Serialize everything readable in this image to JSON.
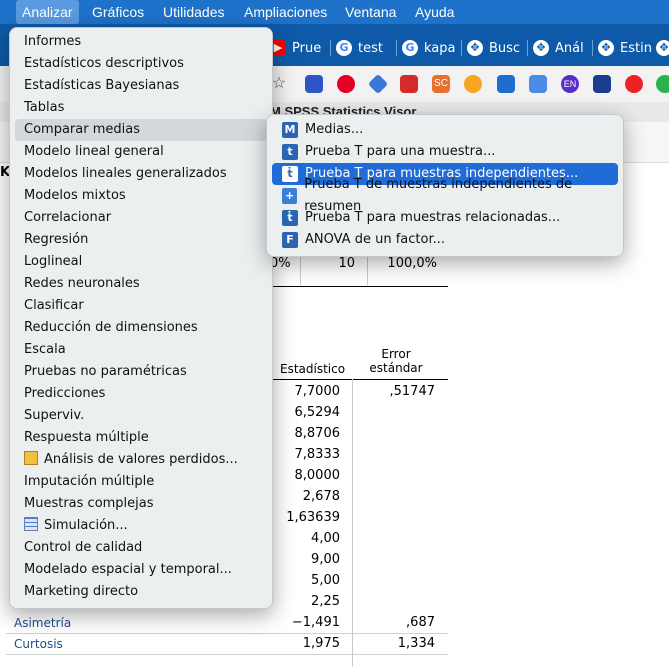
{
  "menubar": {
    "items": [
      "Analizar",
      "Gráficos",
      "Utilidades",
      "Ampliaciones",
      "Ventana",
      "Ayuda"
    ],
    "active": "Analizar"
  },
  "browser_tabs": [
    {
      "label": "Prue",
      "icon": "youtube-icon"
    },
    {
      "label": "test",
      "icon": "google-icon"
    },
    {
      "label": "kapa",
      "icon": "google-icon"
    },
    {
      "label": "Busc",
      "icon": "extension-icon"
    },
    {
      "label": "Anál",
      "icon": "extension-icon"
    },
    {
      "label": "Estin",
      "icon": "extension-icon"
    }
  ],
  "bookbar": {
    "badge_sc": "SC",
    "badge_en": "EN"
  },
  "spss": {
    "title": "M SPSS Statistics Visor"
  },
  "table_top": {
    "left_frag": "K",
    "cells": [
      "0%",
      "10",
      "100,0%"
    ]
  },
  "table_headers": {
    "estadistico": "Estadístico",
    "error": "Error estándar"
  },
  "table_rows": [
    {
      "label": "",
      "estadistico": "7,7000",
      "error": ",51747"
    },
    {
      "label": "",
      "estadistico": "6,5294",
      "error": ""
    },
    {
      "label": "",
      "estadistico": "8,8706",
      "error": ""
    },
    {
      "label": "",
      "estadistico": "7,8333",
      "error": ""
    },
    {
      "label": "",
      "estadistico": "8,0000",
      "error": ""
    },
    {
      "label": "",
      "estadistico": "2,678",
      "error": ""
    },
    {
      "label": "",
      "estadistico": "1,63639",
      "error": ""
    },
    {
      "label": "",
      "estadistico": "4,00",
      "error": ""
    },
    {
      "label": "",
      "estadistico": "9,00",
      "error": ""
    },
    {
      "label": "",
      "estadistico": "5,00",
      "error": ""
    },
    {
      "label": "",
      "estadistico": "2,25",
      "error": ""
    },
    {
      "label": "Asimetría",
      "estadistico": "−1,491",
      "error": ",687"
    },
    {
      "label": "Curtosis",
      "estadistico": "1,975",
      "error": "1,334"
    }
  ],
  "menu": {
    "items": [
      "Informes",
      "Estadísticos descriptivos",
      "Estadísticas Bayesianas",
      "Tablas",
      "Comparar medias",
      "Modelo lineal general",
      "Modelos lineales generalizados",
      "Modelos mixtos",
      "Correlacionar",
      "Regresión",
      "Loglineal",
      "Redes neuronales",
      "Clasificar",
      "Reducción de dimensiones",
      "Escala",
      "Pruebas no paramétricas",
      "Predicciones",
      "Superviv.",
      "Respuesta múltiple",
      "Análisis de valores perdidos...",
      "Imputación múltiple",
      "Muestras complejas",
      "Simulación...",
      "Control de calidad",
      "Modelado espacial y temporal...",
      "Marketing directo"
    ],
    "highlighted": "Comparar medias"
  },
  "submenu": {
    "items": [
      {
        "label": "Medias...",
        "icon": "M"
      },
      {
        "label": "Prueba T para una muestra...",
        "icon": "t"
      },
      {
        "label": "Prueba T para muestras independientes...",
        "icon": "ṫ"
      },
      {
        "label": "Prueba T de muestras independientes de resumen",
        "icon": "+"
      },
      {
        "label": "Prueba T para muestras relacionadas...",
        "icon": "ṫ"
      },
      {
        "label": "ANOVA de un factor...",
        "icon": "F"
      }
    ],
    "selected": "Prueba T para muestras independientes..."
  }
}
